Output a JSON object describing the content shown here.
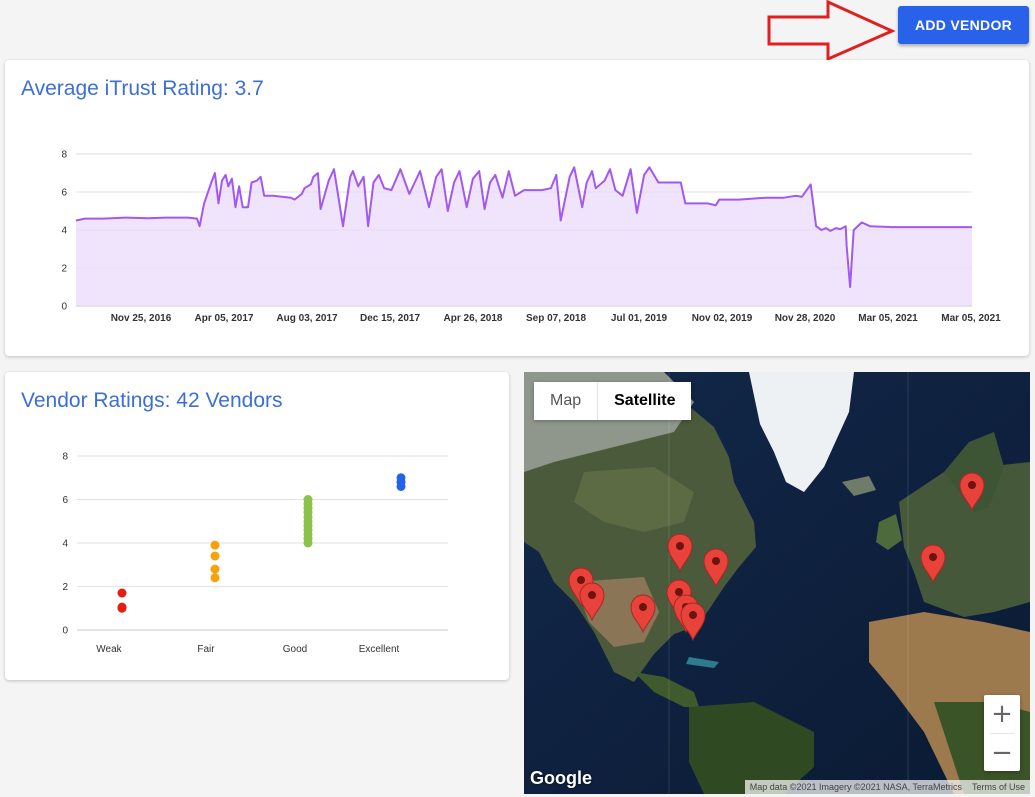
{
  "header": {
    "add_vendor_label": "ADD VENDOR",
    "accent_color": "#2962ea",
    "annotation_color": "#e02020"
  },
  "trend_card": {
    "title": "Average iTrust Rating: 3.7",
    "chart_data": {
      "type": "area",
      "line_color": "#a259f0",
      "fill_color": "#ead9fb",
      "ylim": [
        0,
        8
      ],
      "y_ticks": [
        0,
        2,
        4,
        6,
        8
      ],
      "grid": true,
      "x_tick_labels": [
        "Nov 25, 2016",
        "Apr 05, 2017",
        "Aug 03, 2017",
        "Dec 15, 2017",
        "Apr 26, 2018",
        "Sep 07, 2018",
        "Jul 01, 2019",
        "Nov 02, 2019",
        "Nov 28, 2020",
        "Mar 05, 2021",
        "Mar 05, 2021"
      ],
      "x_range": [
        0,
        100
      ],
      "points": [
        [
          0,
          4.5
        ],
        [
          1,
          4.6
        ],
        [
          3,
          4.6
        ],
        [
          5.5,
          4.65
        ],
        [
          8,
          4.62
        ],
        [
          10,
          4.65
        ],
        [
          12.5,
          4.65
        ],
        [
          13.5,
          4.6
        ],
        [
          13.8,
          4.2
        ],
        [
          14.3,
          5.4
        ],
        [
          15.1,
          6.5
        ],
        [
          15.5,
          7.0
        ],
        [
          15.9,
          5.4
        ],
        [
          16.3,
          6.6
        ],
        [
          16.7,
          6.9
        ],
        [
          17,
          6.3
        ],
        [
          17.4,
          6.7
        ],
        [
          17.8,
          5.2
        ],
        [
          18.2,
          6.3
        ],
        [
          18.6,
          5.2
        ],
        [
          19.2,
          5.2
        ],
        [
          19.6,
          6.5
        ],
        [
          20.2,
          6.6
        ],
        [
          20.6,
          6.8
        ],
        [
          21,
          5.8
        ],
        [
          22,
          5.8
        ],
        [
          24,
          5.7
        ],
        [
          24.4,
          5.6
        ],
        [
          25.2,
          5.9
        ],
        [
          25.5,
          6.2
        ],
        [
          26.2,
          6.4
        ],
        [
          26.5,
          6.8
        ],
        [
          27,
          7.0
        ],
        [
          27.3,
          5.1
        ],
        [
          28.2,
          6.6
        ],
        [
          28.8,
          7.2
        ],
        [
          29.8,
          4.2
        ],
        [
          30.6,
          6.8
        ],
        [
          30.9,
          7.1
        ],
        [
          31.5,
          6.3
        ],
        [
          32.1,
          6.8
        ],
        [
          32.6,
          4.2
        ],
        [
          33.2,
          6.5
        ],
        [
          33.8,
          6.9
        ],
        [
          34.4,
          6.2
        ],
        [
          35.2,
          6.1
        ],
        [
          36.2,
          7.2
        ],
        [
          37.2,
          5.9
        ],
        [
          37.8,
          6.5
        ],
        [
          38.4,
          7.1
        ],
        [
          39.4,
          5.2
        ],
        [
          40.2,
          6.8
        ],
        [
          40.8,
          7.2
        ],
        [
          41.5,
          5.0
        ],
        [
          42.2,
          6.5
        ],
        [
          42.8,
          7.1
        ],
        [
          43.6,
          5.2
        ],
        [
          44.3,
          6.7
        ],
        [
          45,
          7.1
        ],
        [
          45.6,
          5.1
        ],
        [
          46.2,
          6.5
        ],
        [
          46.8,
          6.9
        ],
        [
          47.6,
          5.7
        ],
        [
          48.3,
          7.1
        ],
        [
          49,
          5.8
        ],
        [
          50,
          6.1
        ],
        [
          52,
          6.1
        ],
        [
          53,
          6.2
        ],
        [
          53.6,
          6.9
        ],
        [
          54.1,
          4.5
        ],
        [
          55.1,
          6.8
        ],
        [
          55.6,
          7.3
        ],
        [
          56.5,
          5.2
        ],
        [
          57,
          6.5
        ],
        [
          57.6,
          7.1
        ],
        [
          58,
          6.2
        ],
        [
          59,
          6.6
        ],
        [
          59.6,
          7.2
        ],
        [
          60.2,
          6.1
        ],
        [
          61,
          5.8
        ],
        [
          61.9,
          7.2
        ],
        [
          62.6,
          4.9
        ],
        [
          63.4,
          6.9
        ],
        [
          64,
          7.3
        ],
        [
          65,
          6.5
        ],
        [
          67.5,
          6.5
        ],
        [
          68,
          5.4
        ],
        [
          70.5,
          5.4
        ],
        [
          71.4,
          5.3
        ],
        [
          71.8,
          5.6
        ],
        [
          74,
          5.6
        ],
        [
          77,
          5.7
        ],
        [
          79,
          5.7
        ],
        [
          80.3,
          5.8
        ],
        [
          81,
          5.75
        ],
        [
          82,
          6.4
        ],
        [
          82.6,
          4.2
        ],
        [
          83.2,
          4.0
        ],
        [
          83.7,
          4.1
        ],
        [
          84.2,
          3.95
        ],
        [
          84.8,
          4.1
        ],
        [
          85.3,
          4.05
        ],
        [
          85.9,
          4.2
        ],
        [
          86,
          3.2
        ],
        [
          86.4,
          1.0
        ],
        [
          86.8,
          4.0
        ],
        [
          87.7,
          4.4
        ],
        [
          88.6,
          4.2
        ],
        [
          91,
          4.15
        ],
        [
          95,
          4.15
        ],
        [
          100,
          4.15
        ]
      ]
    }
  },
  "ratings_card": {
    "title": "Vendor Ratings: 42 Vendors",
    "chart_data": {
      "type": "scatter",
      "ylim": [
        0,
        8
      ],
      "y_ticks": [
        0,
        2,
        4,
        6,
        8
      ],
      "grid": true,
      "categories": [
        "Weak",
        "Fair",
        "Good",
        "Excellent"
      ],
      "series": [
        {
          "color": "#e61e10",
          "values": [
            1.7,
            1.0,
            1.05
          ]
        },
        {
          "color": "#f7a10c",
          "values": [
            3.9,
            3.4,
            2.8,
            2.4
          ]
        },
        {
          "color": "#8bc34a",
          "values": [
            6.0,
            5.8,
            5.6,
            5.4,
            5.2,
            5.0,
            4.8,
            4.6,
            4.4,
            4.2,
            4.0
          ]
        },
        {
          "color": "#2463e8",
          "values": [
            7.0,
            6.8,
            6.6
          ]
        }
      ]
    }
  },
  "map": {
    "type_options": [
      "Map",
      "Satellite"
    ],
    "selected_type": "Satellite",
    "zoom_in_label": "+",
    "zoom_out_label": "−",
    "logo_text": "Google",
    "attribution": "Map data ©2021 Imagery ©2021 NASA, TerraMetrics",
    "terms_label": "Terms of Use",
    "marker_color": "#e8423a",
    "marker_count": 10
  }
}
